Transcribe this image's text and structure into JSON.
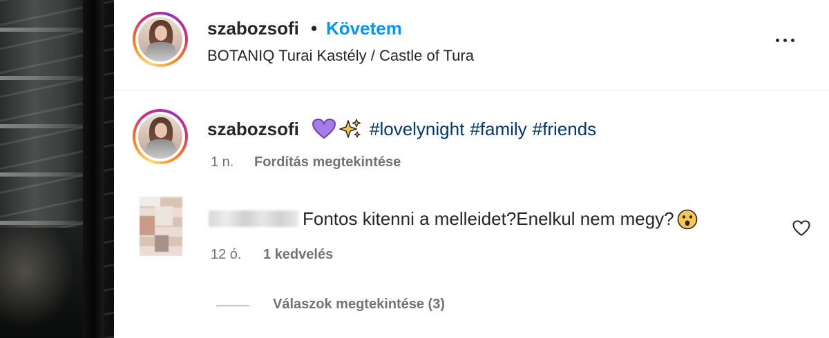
{
  "header": {
    "username": "szabozsofi",
    "separator": "•",
    "follow_label": "Követem",
    "location": "BOTANIQ Turai Kastély / Castle of Tura",
    "more_icon": "more-horizontal-icon"
  },
  "caption": {
    "username": "szabozsofi",
    "emojis": [
      "purple-heart-icon",
      "sparkles-icon"
    ],
    "hashtags": [
      "#lovelynight",
      "#family",
      "#friends"
    ],
    "time": "1 n.",
    "translate_label": "Fordítás megtekintése"
  },
  "comment": {
    "text": "Fontos kitenni a melleidet?Enelkul nem megy?",
    "emoji": "astonished-face-icon",
    "time": "12 ó.",
    "likes": "1 kedvelés",
    "replies_label": "Válaszok megtekintése (3)"
  },
  "colors": {
    "accent": "#0095f6",
    "hashtag": "#00376b",
    "secondary_text": "#737373",
    "primary_text": "#262626"
  }
}
